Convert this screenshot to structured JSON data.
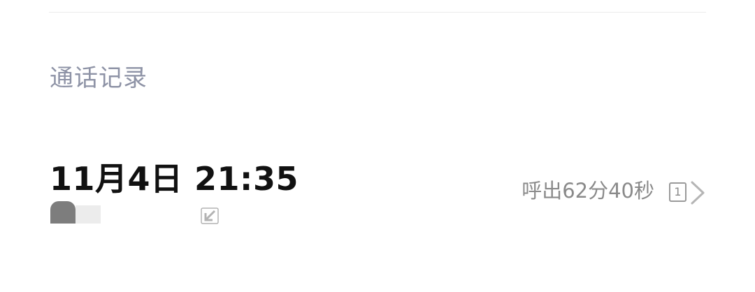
{
  "call_log": {
    "section_title": "通话记录",
    "entries": [
      {
        "datetime": "11月4日 21:35",
        "summary": "呼出62分40秒",
        "sim": "1",
        "type_icon": "outgoing-call-icon",
        "chevron_icon": "chevron-right-icon"
      }
    ]
  },
  "colors": {
    "title": "#8e93a6",
    "primary_text": "#111111",
    "secondary_text": "#8a8a8a",
    "divider": "#ebebeb"
  }
}
